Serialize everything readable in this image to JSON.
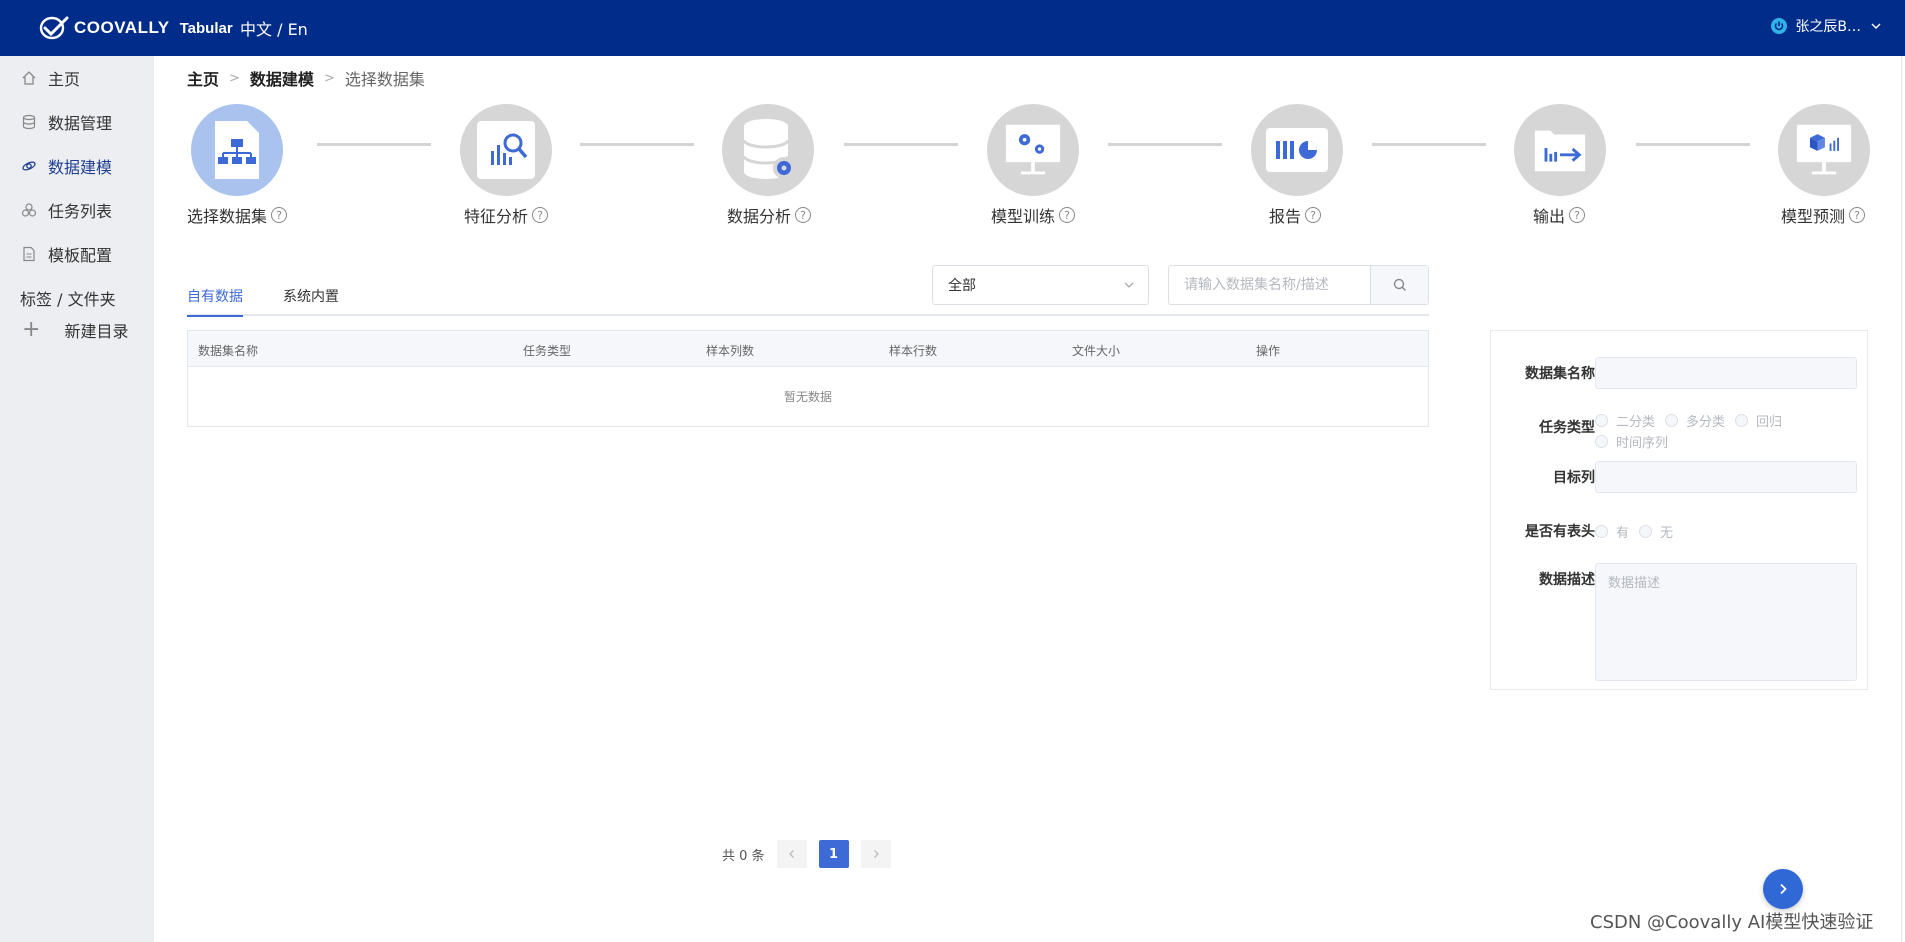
{
  "header": {
    "logo_text": "COOVALLY",
    "logo_sub": "Tabular",
    "language": "中文 / En",
    "user_name": "张之辰B…"
  },
  "sidebar": {
    "items": [
      {
        "label": "主页",
        "icon": "home-icon"
      },
      {
        "label": "数据管理",
        "icon": "database-icon"
      },
      {
        "label": "数据建模",
        "icon": "modeling-icon"
      },
      {
        "label": "任务列表",
        "icon": "tasks-icon"
      },
      {
        "label": "模板配置",
        "icon": "template-icon"
      }
    ],
    "section_label": "标签 / 文件夹",
    "new_folder": "新建目录"
  },
  "breadcrumb": {
    "home": "主页",
    "parent": "数据建模",
    "current": "选择数据集"
  },
  "steps": [
    {
      "label": "选择数据集",
      "icon": "dataset-select-icon",
      "active": true
    },
    {
      "label": "特征分析",
      "icon": "feature-analysis-icon",
      "active": false
    },
    {
      "label": "数据分析",
      "icon": "data-analysis-icon",
      "active": false
    },
    {
      "label": "模型训练",
      "icon": "model-training-icon",
      "active": false
    },
    {
      "label": "报告",
      "icon": "report-icon",
      "active": false
    },
    {
      "label": "输出",
      "icon": "output-icon",
      "active": false
    },
    {
      "label": "模型预测",
      "icon": "model-predict-icon",
      "active": false
    }
  ],
  "tabs": [
    {
      "label": "自有数据",
      "active": true
    },
    {
      "label": "系统内置",
      "active": false
    }
  ],
  "filter": {
    "selected": "全部",
    "search_placeholder": "请输入数据集名称/描述"
  },
  "table": {
    "columns": [
      "数据集名称",
      "任务类型",
      "样本列数",
      "样本行数",
      "文件大小",
      "操作"
    ],
    "rows": [],
    "empty_text": "暂无数据"
  },
  "pagination": {
    "total_text": "共 0 条",
    "current_page": "1"
  },
  "form": {
    "name_label": "数据集名称",
    "task_type_label": "任务类型",
    "task_options": [
      "二分类",
      "多分类",
      "回归",
      "时间序列"
    ],
    "target_label": "目标列",
    "header_label": "是否有表头",
    "header_options": [
      "有",
      "无"
    ],
    "desc_label": "数据描述",
    "desc_placeholder": "数据描述"
  },
  "watermark": "CSDN @Coovally   AI模型快速验证",
  "colors": {
    "header_bg": "#012c8a",
    "accent": "#3d6ad6",
    "active_step": "#a9c2ee",
    "inactive_step": "#d6d6d6"
  }
}
